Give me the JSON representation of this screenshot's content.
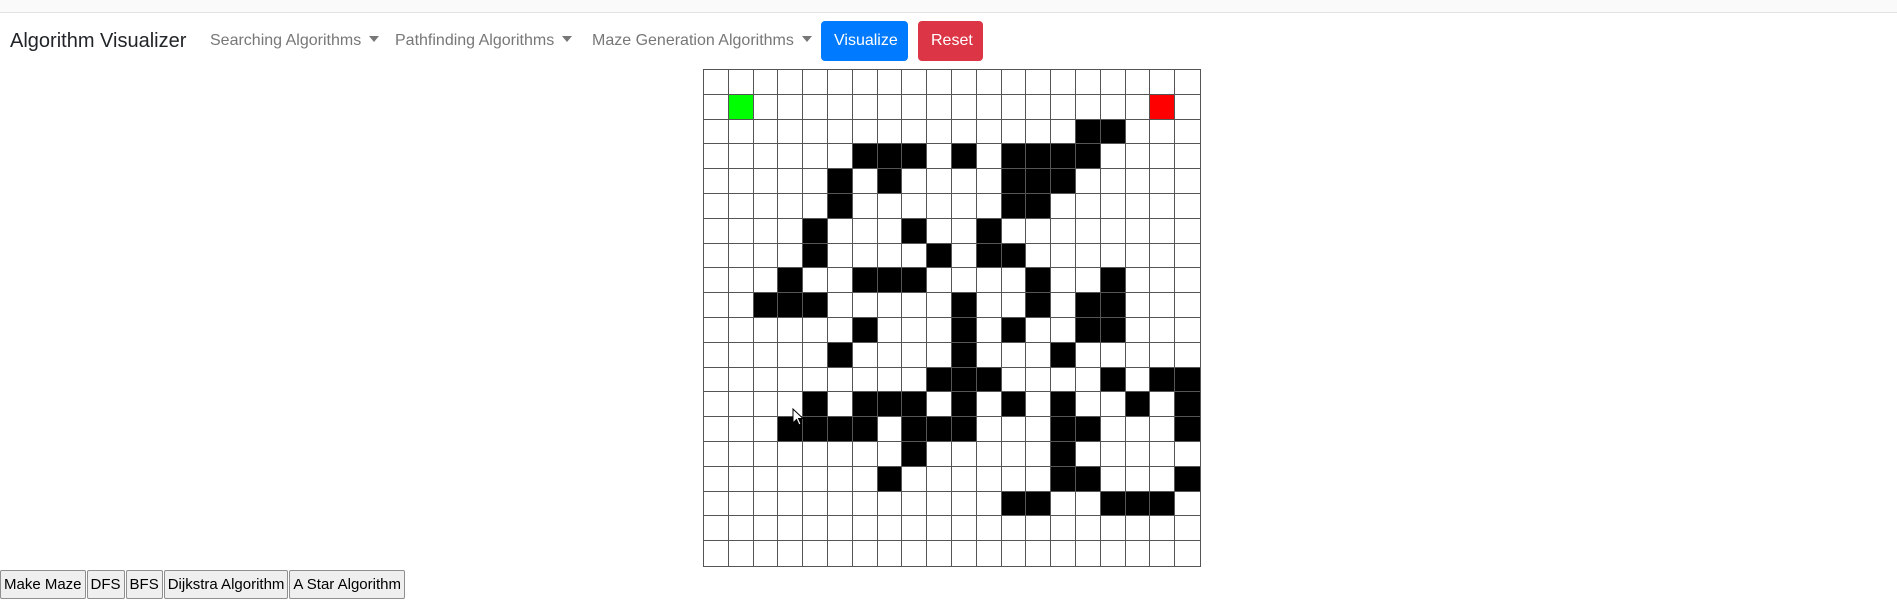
{
  "navbar": {
    "brand": "Algorithm Visualizer",
    "dropdowns": [
      {
        "label": "Searching Algorithms"
      },
      {
        "label": "Pathfinding Algorithms"
      },
      {
        "label": "Maze Generation Algorithms"
      }
    ],
    "visualize_label": "Visualize",
    "reset_label": "Reset"
  },
  "colors": {
    "primary": "#007bff",
    "danger": "#dc3545",
    "wall": "#000000",
    "start": "#00ff00",
    "end": "#ff0000"
  },
  "grid": {
    "rows": 20,
    "cols": 20,
    "start": [
      1,
      1
    ],
    "end": [
      1,
      18
    ],
    "walls": [
      [
        2,
        15
      ],
      [
        2,
        16
      ],
      [
        3,
        6
      ],
      [
        3,
        7
      ],
      [
        3,
        8
      ],
      [
        3,
        10
      ],
      [
        3,
        12
      ],
      [
        3,
        13
      ],
      [
        3,
        14
      ],
      [
        3,
        15
      ],
      [
        4,
        5
      ],
      [
        4,
        7
      ],
      [
        4,
        12
      ],
      [
        4,
        13
      ],
      [
        4,
        14
      ],
      [
        5,
        5
      ],
      [
        5,
        12
      ],
      [
        5,
        13
      ],
      [
        6,
        4
      ],
      [
        6,
        8
      ],
      [
        6,
        11
      ],
      [
        7,
        4
      ],
      [
        7,
        9
      ],
      [
        7,
        11
      ],
      [
        7,
        12
      ],
      [
        8,
        3
      ],
      [
        8,
        6
      ],
      [
        8,
        7
      ],
      [
        8,
        8
      ],
      [
        8,
        13
      ],
      [
        8,
        16
      ],
      [
        9,
        2
      ],
      [
        9,
        3
      ],
      [
        9,
        4
      ],
      [
        9,
        10
      ],
      [
        9,
        13
      ],
      [
        9,
        15
      ],
      [
        9,
        16
      ],
      [
        10,
        6
      ],
      [
        10,
        10
      ],
      [
        10,
        12
      ],
      [
        10,
        15
      ],
      [
        10,
        16
      ],
      [
        11,
        5
      ],
      [
        11,
        10
      ],
      [
        11,
        14
      ],
      [
        12,
        9
      ],
      [
        12,
        10
      ],
      [
        12,
        11
      ],
      [
        12,
        16
      ],
      [
        12,
        18
      ],
      [
        12,
        19
      ],
      [
        13,
        4
      ],
      [
        13,
        6
      ],
      [
        13,
        7
      ],
      [
        13,
        8
      ],
      [
        13,
        10
      ],
      [
        13,
        12
      ],
      [
        13,
        14
      ],
      [
        13,
        17
      ],
      [
        13,
        19
      ],
      [
        14,
        3
      ],
      [
        14,
        4
      ],
      [
        14,
        5
      ],
      [
        14,
        6
      ],
      [
        14,
        8
      ],
      [
        14,
        9
      ],
      [
        14,
        10
      ],
      [
        14,
        14
      ],
      [
        14,
        15
      ],
      [
        14,
        19
      ],
      [
        15,
        8
      ],
      [
        15,
        14
      ],
      [
        16,
        7
      ],
      [
        16,
        14
      ],
      [
        16,
        15
      ],
      [
        16,
        19
      ],
      [
        17,
        12
      ],
      [
        17,
        13
      ],
      [
        17,
        16
      ],
      [
        17,
        17
      ],
      [
        17,
        18
      ]
    ]
  },
  "bottom_buttons": {
    "make_maze": "Make Maze",
    "dfs": "DFS",
    "bfs": "BFS",
    "dijkstra": "Dijkstra Algorithm",
    "astar": "A Star Algorithm"
  }
}
